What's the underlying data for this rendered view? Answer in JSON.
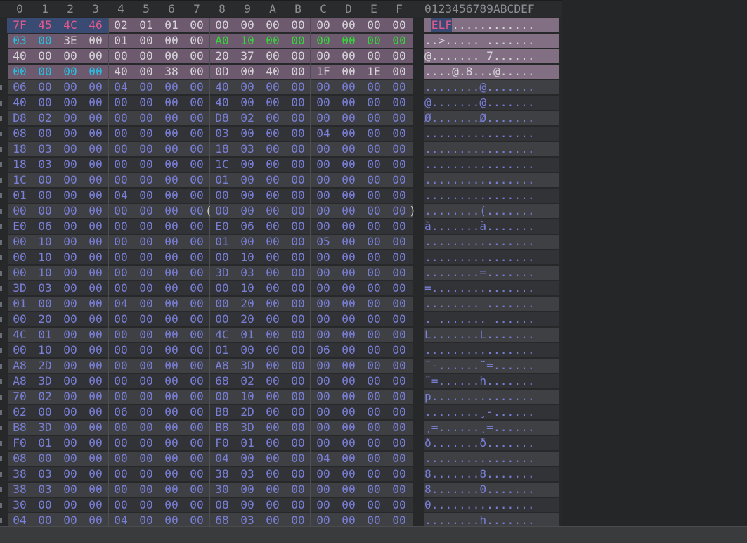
{
  "header": {
    "columns": [
      "0",
      "1",
      "2",
      "3",
      "4",
      "5",
      "6",
      "7",
      "8",
      "9",
      "A",
      "B",
      "C",
      "D",
      "E",
      "F"
    ],
    "ascii_header": "0123456789ABCDEF"
  },
  "colors": {
    "background": "#27282a",
    "band_dark": "#323336",
    "band_light": "#3f4044",
    "header_selection": "#6e5a6f",
    "ascii_header_selection": "#826f84",
    "default_byte": "#7a7fd8",
    "magic_byte": "#e25a8a",
    "magic_selection": "#394a73",
    "header_byte": "#d8d4da",
    "cyan_byte": "#29c0e4",
    "green_byte": "#33d838",
    "ascii_text": "#7a7fd8"
  },
  "rows": [
    {
      "bytes": [
        "7F",
        "45",
        "4C",
        "46",
        "02",
        "01",
        "01",
        "00",
        "00",
        "00",
        "00",
        "00",
        "00",
        "00",
        "00",
        "00"
      ],
      "ascii": " ELF............",
      "colors": [
        "m",
        "m",
        "m",
        "m",
        "h",
        "h",
        "h",
        "h",
        "h",
        "h",
        "h",
        "h",
        "h",
        "h",
        "h",
        "h"
      ],
      "selected": true
    },
    {
      "bytes": [
        "03",
        "00",
        "3E",
        "00",
        "01",
        "00",
        "00",
        "00",
        "A0",
        "10",
        "00",
        "00",
        "00",
        "00",
        "00",
        "00"
      ],
      "ascii": "..>..... .......",
      "colors": [
        "c",
        "c",
        "h",
        "h",
        "h",
        "h",
        "h",
        "h",
        "g",
        "g",
        "g",
        "g",
        "g",
        "g",
        "g",
        "g"
      ],
      "selected": true
    },
    {
      "bytes": [
        "40",
        "00",
        "00",
        "00",
        "00",
        "00",
        "00",
        "00",
        "20",
        "37",
        "00",
        "00",
        "00",
        "00",
        "00",
        "00"
      ],
      "ascii": "@....... 7......",
      "colors": [
        "h",
        "h",
        "h",
        "h",
        "h",
        "h",
        "h",
        "h",
        "h",
        "h",
        "h",
        "h",
        "h",
        "h",
        "h",
        "h"
      ],
      "selected": true
    },
    {
      "bytes": [
        "00",
        "00",
        "00",
        "00",
        "40",
        "00",
        "38",
        "00",
        "0D",
        "00",
        "40",
        "00",
        "1F",
        "00",
        "1E",
        "00"
      ],
      "ascii": "....@.8...@.....",
      "colors": [
        "c",
        "c",
        "c",
        "c",
        "h",
        "h",
        "h",
        "h",
        "h",
        "h",
        "h",
        "h",
        "h",
        "h",
        "h",
        "h"
      ],
      "selected": true
    },
    {
      "bytes": [
        "06",
        "00",
        "00",
        "00",
        "04",
        "00",
        "00",
        "00",
        "40",
        "00",
        "00",
        "00",
        "00",
        "00",
        "00",
        "00"
      ],
      "ascii": "........@......."
    },
    {
      "bytes": [
        "40",
        "00",
        "00",
        "00",
        "00",
        "00",
        "00",
        "00",
        "40",
        "00",
        "00",
        "00",
        "00",
        "00",
        "00",
        "00"
      ],
      "ascii": "@.......@......."
    },
    {
      "bytes": [
        "D8",
        "02",
        "00",
        "00",
        "00",
        "00",
        "00",
        "00",
        "D8",
        "02",
        "00",
        "00",
        "00",
        "00",
        "00",
        "00"
      ],
      "ascii": "Ø.......Ø......."
    },
    {
      "bytes": [
        "08",
        "00",
        "00",
        "00",
        "00",
        "00",
        "00",
        "00",
        "03",
        "00",
        "00",
        "00",
        "04",
        "00",
        "00",
        "00"
      ],
      "ascii": "................"
    },
    {
      "bytes": [
        "18",
        "03",
        "00",
        "00",
        "00",
        "00",
        "00",
        "00",
        "18",
        "03",
        "00",
        "00",
        "00",
        "00",
        "00",
        "00"
      ],
      "ascii": "................"
    },
    {
      "bytes": [
        "18",
        "03",
        "00",
        "00",
        "00",
        "00",
        "00",
        "00",
        "1C",
        "00",
        "00",
        "00",
        "00",
        "00",
        "00",
        "00"
      ],
      "ascii": "................"
    },
    {
      "bytes": [
        "1C",
        "00",
        "00",
        "00",
        "00",
        "00",
        "00",
        "00",
        "01",
        "00",
        "00",
        "00",
        "00",
        "00",
        "00",
        "00"
      ],
      "ascii": "................"
    },
    {
      "bytes": [
        "01",
        "00",
        "00",
        "00",
        "04",
        "00",
        "00",
        "00",
        "00",
        "00",
        "00",
        "00",
        "00",
        "00",
        "00",
        "00"
      ],
      "ascii": "................"
    },
    {
      "bytes": [
        "00",
        "00",
        "00",
        "00",
        "00",
        "00",
        "00",
        "00",
        "00",
        "00",
        "00",
        "00",
        "00",
        "00",
        "00",
        "00"
      ],
      "ascii": "........(.......",
      "bracket": true
    },
    {
      "bytes": [
        "E0",
        "06",
        "00",
        "00",
        "00",
        "00",
        "00",
        "00",
        "E0",
        "06",
        "00",
        "00",
        "00",
        "00",
        "00",
        "00"
      ],
      "ascii": "à.......à......."
    },
    {
      "bytes": [
        "00",
        "10",
        "00",
        "00",
        "00",
        "00",
        "00",
        "00",
        "01",
        "00",
        "00",
        "00",
        "05",
        "00",
        "00",
        "00"
      ],
      "ascii": "................"
    },
    {
      "bytes": [
        "00",
        "10",
        "00",
        "00",
        "00",
        "00",
        "00",
        "00",
        "00",
        "10",
        "00",
        "00",
        "00",
        "00",
        "00",
        "00"
      ],
      "ascii": "................"
    },
    {
      "bytes": [
        "00",
        "10",
        "00",
        "00",
        "00",
        "00",
        "00",
        "00",
        "3D",
        "03",
        "00",
        "00",
        "00",
        "00",
        "00",
        "00"
      ],
      "ascii": "........=......."
    },
    {
      "bytes": [
        "3D",
        "03",
        "00",
        "00",
        "00",
        "00",
        "00",
        "00",
        "00",
        "10",
        "00",
        "00",
        "00",
        "00",
        "00",
        "00"
      ],
      "ascii": "=..............."
    },
    {
      "bytes": [
        "01",
        "00",
        "00",
        "00",
        "04",
        "00",
        "00",
        "00",
        "00",
        "20",
        "00",
        "00",
        "00",
        "00",
        "00",
        "00"
      ],
      "ascii": "........ ......."
    },
    {
      "bytes": [
        "00",
        "20",
        "00",
        "00",
        "00",
        "00",
        "00",
        "00",
        "00",
        "20",
        "00",
        "00",
        "00",
        "00",
        "00",
        "00"
      ],
      "ascii": ". ....... ......"
    },
    {
      "bytes": [
        "4C",
        "01",
        "00",
        "00",
        "00",
        "00",
        "00",
        "00",
        "4C",
        "01",
        "00",
        "00",
        "00",
        "00",
        "00",
        "00"
      ],
      "ascii": "L.......L......."
    },
    {
      "bytes": [
        "00",
        "10",
        "00",
        "00",
        "00",
        "00",
        "00",
        "00",
        "01",
        "00",
        "00",
        "00",
        "06",
        "00",
        "00",
        "00"
      ],
      "ascii": "................"
    },
    {
      "bytes": [
        "A8",
        "2D",
        "00",
        "00",
        "00",
        "00",
        "00",
        "00",
        "A8",
        "3D",
        "00",
        "00",
        "00",
        "00",
        "00",
        "00"
      ],
      "ascii": "¨-......¨=......"
    },
    {
      "bytes": [
        "A8",
        "3D",
        "00",
        "00",
        "00",
        "00",
        "00",
        "00",
        "68",
        "02",
        "00",
        "00",
        "00",
        "00",
        "00",
        "00"
      ],
      "ascii": "¨=......h......."
    },
    {
      "bytes": [
        "70",
        "02",
        "00",
        "00",
        "00",
        "00",
        "00",
        "00",
        "00",
        "10",
        "00",
        "00",
        "00",
        "00",
        "00",
        "00"
      ],
      "ascii": "p..............."
    },
    {
      "bytes": [
        "02",
        "00",
        "00",
        "00",
        "06",
        "00",
        "00",
        "00",
        "B8",
        "2D",
        "00",
        "00",
        "00",
        "00",
        "00",
        "00"
      ],
      "ascii": "........¸-......"
    },
    {
      "bytes": [
        "B8",
        "3D",
        "00",
        "00",
        "00",
        "00",
        "00",
        "00",
        "B8",
        "3D",
        "00",
        "00",
        "00",
        "00",
        "00",
        "00"
      ],
      "ascii": "¸=......¸=......"
    },
    {
      "bytes": [
        "F0",
        "01",
        "00",
        "00",
        "00",
        "00",
        "00",
        "00",
        "F0",
        "01",
        "00",
        "00",
        "00",
        "00",
        "00",
        "00"
      ],
      "ascii": "ð.......ð......."
    },
    {
      "bytes": [
        "08",
        "00",
        "00",
        "00",
        "00",
        "00",
        "00",
        "00",
        "04",
        "00",
        "00",
        "00",
        "04",
        "00",
        "00",
        "00"
      ],
      "ascii": "................"
    },
    {
      "bytes": [
        "38",
        "03",
        "00",
        "00",
        "00",
        "00",
        "00",
        "00",
        "38",
        "03",
        "00",
        "00",
        "00",
        "00",
        "00",
        "00"
      ],
      "ascii": "8.......8......."
    },
    {
      "bytes": [
        "38",
        "03",
        "00",
        "00",
        "00",
        "00",
        "00",
        "00",
        "30",
        "00",
        "00",
        "00",
        "00",
        "00",
        "00",
        "00"
      ],
      "ascii": "8.......0......."
    },
    {
      "bytes": [
        "30",
        "00",
        "00",
        "00",
        "00",
        "00",
        "00",
        "00",
        "08",
        "00",
        "00",
        "00",
        "00",
        "00",
        "00",
        "00"
      ],
      "ascii": "0..............."
    },
    {
      "bytes": [
        "04",
        "00",
        "00",
        "00",
        "04",
        "00",
        "00",
        "00",
        "68",
        "03",
        "00",
        "00",
        "00",
        "00",
        "00",
        "00"
      ],
      "ascii": "........h......."
    }
  ]
}
